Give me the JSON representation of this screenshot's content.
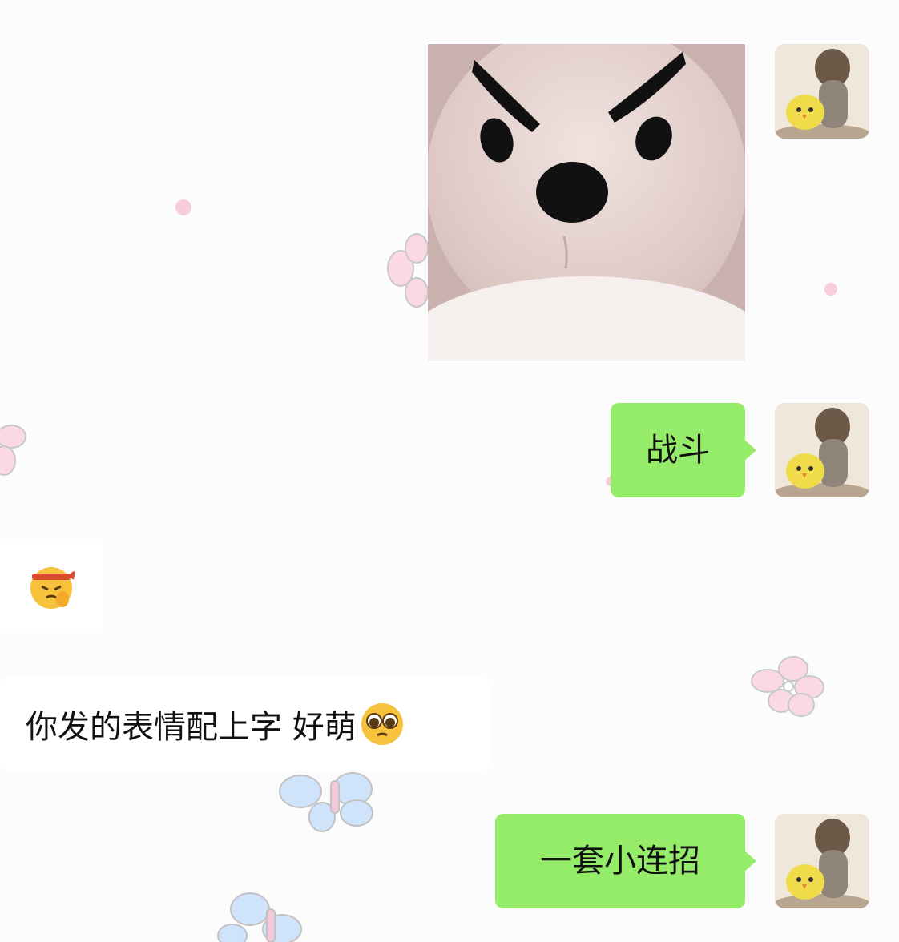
{
  "messages": [
    {
      "side": "right",
      "type": "sticker",
      "sticker_name": "angry-plush-bear"
    },
    {
      "side": "right",
      "type": "text",
      "text": "战斗"
    },
    {
      "side": "left",
      "type": "emoji",
      "emoji_name": "saluting-headband-face"
    },
    {
      "side": "left",
      "type": "text",
      "text": "你发的表情配上字 好萌",
      "trailing_emoji": "pleading-face"
    },
    {
      "side": "right",
      "type": "text",
      "text": "一套小连招"
    }
  ],
  "colors": {
    "background": "#fdfcfd",
    "sent_bubble": "#95ec69",
    "received_bubble": "#ffffff",
    "text": "#111111"
  },
  "icons": {
    "my_avatar": "cat-with-chick-avatar",
    "background_decor": "flower-butterfly-doodles"
  }
}
